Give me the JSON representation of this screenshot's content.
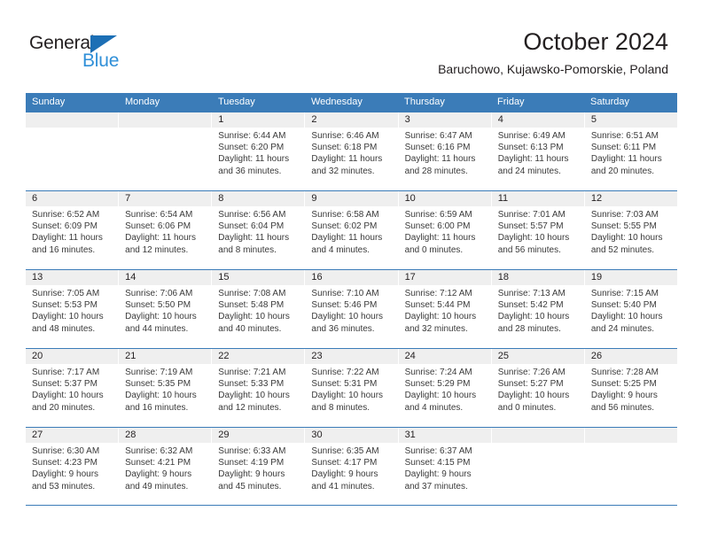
{
  "brand": {
    "name_part1": "General",
    "name_part2": "Blue",
    "triangle_icon": "triangle-icon",
    "color_dark": "#231f20",
    "color_blue": "#2f8fd8"
  },
  "header": {
    "title": "October 2024",
    "location": "Baruchowo, Kujawsko-Pomorskie, Poland"
  },
  "theme": {
    "header_bar": "#3b7cb8",
    "day_band": "#efefef",
    "text": "#231f20"
  },
  "weekdays": [
    "Sunday",
    "Monday",
    "Tuesday",
    "Wednesday",
    "Thursday",
    "Friday",
    "Saturday"
  ],
  "weeks": [
    [
      {
        "day": "",
        "sunrise": "",
        "sunset": "",
        "daylight_line1": "",
        "daylight_line2": "",
        "empty": true
      },
      {
        "day": "",
        "sunrise": "",
        "sunset": "",
        "daylight_line1": "",
        "daylight_line2": "",
        "empty": true
      },
      {
        "day": "1",
        "sunrise": "Sunrise: 6:44 AM",
        "sunset": "Sunset: 6:20 PM",
        "daylight_line1": "Daylight: 11 hours",
        "daylight_line2": "and 36 minutes."
      },
      {
        "day": "2",
        "sunrise": "Sunrise: 6:46 AM",
        "sunset": "Sunset: 6:18 PM",
        "daylight_line1": "Daylight: 11 hours",
        "daylight_line2": "and 32 minutes."
      },
      {
        "day": "3",
        "sunrise": "Sunrise: 6:47 AM",
        "sunset": "Sunset: 6:16 PM",
        "daylight_line1": "Daylight: 11 hours",
        "daylight_line2": "and 28 minutes."
      },
      {
        "day": "4",
        "sunrise": "Sunrise: 6:49 AM",
        "sunset": "Sunset: 6:13 PM",
        "daylight_line1": "Daylight: 11 hours",
        "daylight_line2": "and 24 minutes."
      },
      {
        "day": "5",
        "sunrise": "Sunrise: 6:51 AM",
        "sunset": "Sunset: 6:11 PM",
        "daylight_line1": "Daylight: 11 hours",
        "daylight_line2": "and 20 minutes."
      }
    ],
    [
      {
        "day": "6",
        "sunrise": "Sunrise: 6:52 AM",
        "sunset": "Sunset: 6:09 PM",
        "daylight_line1": "Daylight: 11 hours",
        "daylight_line2": "and 16 minutes."
      },
      {
        "day": "7",
        "sunrise": "Sunrise: 6:54 AM",
        "sunset": "Sunset: 6:06 PM",
        "daylight_line1": "Daylight: 11 hours",
        "daylight_line2": "and 12 minutes."
      },
      {
        "day": "8",
        "sunrise": "Sunrise: 6:56 AM",
        "sunset": "Sunset: 6:04 PM",
        "daylight_line1": "Daylight: 11 hours",
        "daylight_line2": "and 8 minutes."
      },
      {
        "day": "9",
        "sunrise": "Sunrise: 6:58 AM",
        "sunset": "Sunset: 6:02 PM",
        "daylight_line1": "Daylight: 11 hours",
        "daylight_line2": "and 4 minutes."
      },
      {
        "day": "10",
        "sunrise": "Sunrise: 6:59 AM",
        "sunset": "Sunset: 6:00 PM",
        "daylight_line1": "Daylight: 11 hours",
        "daylight_line2": "and 0 minutes."
      },
      {
        "day": "11",
        "sunrise": "Sunrise: 7:01 AM",
        "sunset": "Sunset: 5:57 PM",
        "daylight_line1": "Daylight: 10 hours",
        "daylight_line2": "and 56 minutes."
      },
      {
        "day": "12",
        "sunrise": "Sunrise: 7:03 AM",
        "sunset": "Sunset: 5:55 PM",
        "daylight_line1": "Daylight: 10 hours",
        "daylight_line2": "and 52 minutes."
      }
    ],
    [
      {
        "day": "13",
        "sunrise": "Sunrise: 7:05 AM",
        "sunset": "Sunset: 5:53 PM",
        "daylight_line1": "Daylight: 10 hours",
        "daylight_line2": "and 48 minutes."
      },
      {
        "day": "14",
        "sunrise": "Sunrise: 7:06 AM",
        "sunset": "Sunset: 5:50 PM",
        "daylight_line1": "Daylight: 10 hours",
        "daylight_line2": "and 44 minutes."
      },
      {
        "day": "15",
        "sunrise": "Sunrise: 7:08 AM",
        "sunset": "Sunset: 5:48 PM",
        "daylight_line1": "Daylight: 10 hours",
        "daylight_line2": "and 40 minutes."
      },
      {
        "day": "16",
        "sunrise": "Sunrise: 7:10 AM",
        "sunset": "Sunset: 5:46 PM",
        "daylight_line1": "Daylight: 10 hours",
        "daylight_line2": "and 36 minutes."
      },
      {
        "day": "17",
        "sunrise": "Sunrise: 7:12 AM",
        "sunset": "Sunset: 5:44 PM",
        "daylight_line1": "Daylight: 10 hours",
        "daylight_line2": "and 32 minutes."
      },
      {
        "day": "18",
        "sunrise": "Sunrise: 7:13 AM",
        "sunset": "Sunset: 5:42 PM",
        "daylight_line1": "Daylight: 10 hours",
        "daylight_line2": "and 28 minutes."
      },
      {
        "day": "19",
        "sunrise": "Sunrise: 7:15 AM",
        "sunset": "Sunset: 5:40 PM",
        "daylight_line1": "Daylight: 10 hours",
        "daylight_line2": "and 24 minutes."
      }
    ],
    [
      {
        "day": "20",
        "sunrise": "Sunrise: 7:17 AM",
        "sunset": "Sunset: 5:37 PM",
        "daylight_line1": "Daylight: 10 hours",
        "daylight_line2": "and 20 minutes."
      },
      {
        "day": "21",
        "sunrise": "Sunrise: 7:19 AM",
        "sunset": "Sunset: 5:35 PM",
        "daylight_line1": "Daylight: 10 hours",
        "daylight_line2": "and 16 minutes."
      },
      {
        "day": "22",
        "sunrise": "Sunrise: 7:21 AM",
        "sunset": "Sunset: 5:33 PM",
        "daylight_line1": "Daylight: 10 hours",
        "daylight_line2": "and 12 minutes."
      },
      {
        "day": "23",
        "sunrise": "Sunrise: 7:22 AM",
        "sunset": "Sunset: 5:31 PM",
        "daylight_line1": "Daylight: 10 hours",
        "daylight_line2": "and 8 minutes."
      },
      {
        "day": "24",
        "sunrise": "Sunrise: 7:24 AM",
        "sunset": "Sunset: 5:29 PM",
        "daylight_line1": "Daylight: 10 hours",
        "daylight_line2": "and 4 minutes."
      },
      {
        "day": "25",
        "sunrise": "Sunrise: 7:26 AM",
        "sunset": "Sunset: 5:27 PM",
        "daylight_line1": "Daylight: 10 hours",
        "daylight_line2": "and 0 minutes."
      },
      {
        "day": "26",
        "sunrise": "Sunrise: 7:28 AM",
        "sunset": "Sunset: 5:25 PM",
        "daylight_line1": "Daylight: 9 hours",
        "daylight_line2": "and 56 minutes."
      }
    ],
    [
      {
        "day": "27",
        "sunrise": "Sunrise: 6:30 AM",
        "sunset": "Sunset: 4:23 PM",
        "daylight_line1": "Daylight: 9 hours",
        "daylight_line2": "and 53 minutes."
      },
      {
        "day": "28",
        "sunrise": "Sunrise: 6:32 AM",
        "sunset": "Sunset: 4:21 PM",
        "daylight_line1": "Daylight: 9 hours",
        "daylight_line2": "and 49 minutes."
      },
      {
        "day": "29",
        "sunrise": "Sunrise: 6:33 AM",
        "sunset": "Sunset: 4:19 PM",
        "daylight_line1": "Daylight: 9 hours",
        "daylight_line2": "and 45 minutes."
      },
      {
        "day": "30",
        "sunrise": "Sunrise: 6:35 AM",
        "sunset": "Sunset: 4:17 PM",
        "daylight_line1": "Daylight: 9 hours",
        "daylight_line2": "and 41 minutes."
      },
      {
        "day": "31",
        "sunrise": "Sunrise: 6:37 AM",
        "sunset": "Sunset: 4:15 PM",
        "daylight_line1": "Daylight: 9 hours",
        "daylight_line2": "and 37 minutes."
      },
      {
        "day": "",
        "sunrise": "",
        "sunset": "",
        "daylight_line1": "",
        "daylight_line2": "",
        "empty": true
      },
      {
        "day": "",
        "sunrise": "",
        "sunset": "",
        "daylight_line1": "",
        "daylight_line2": "",
        "empty": true
      }
    ]
  ]
}
